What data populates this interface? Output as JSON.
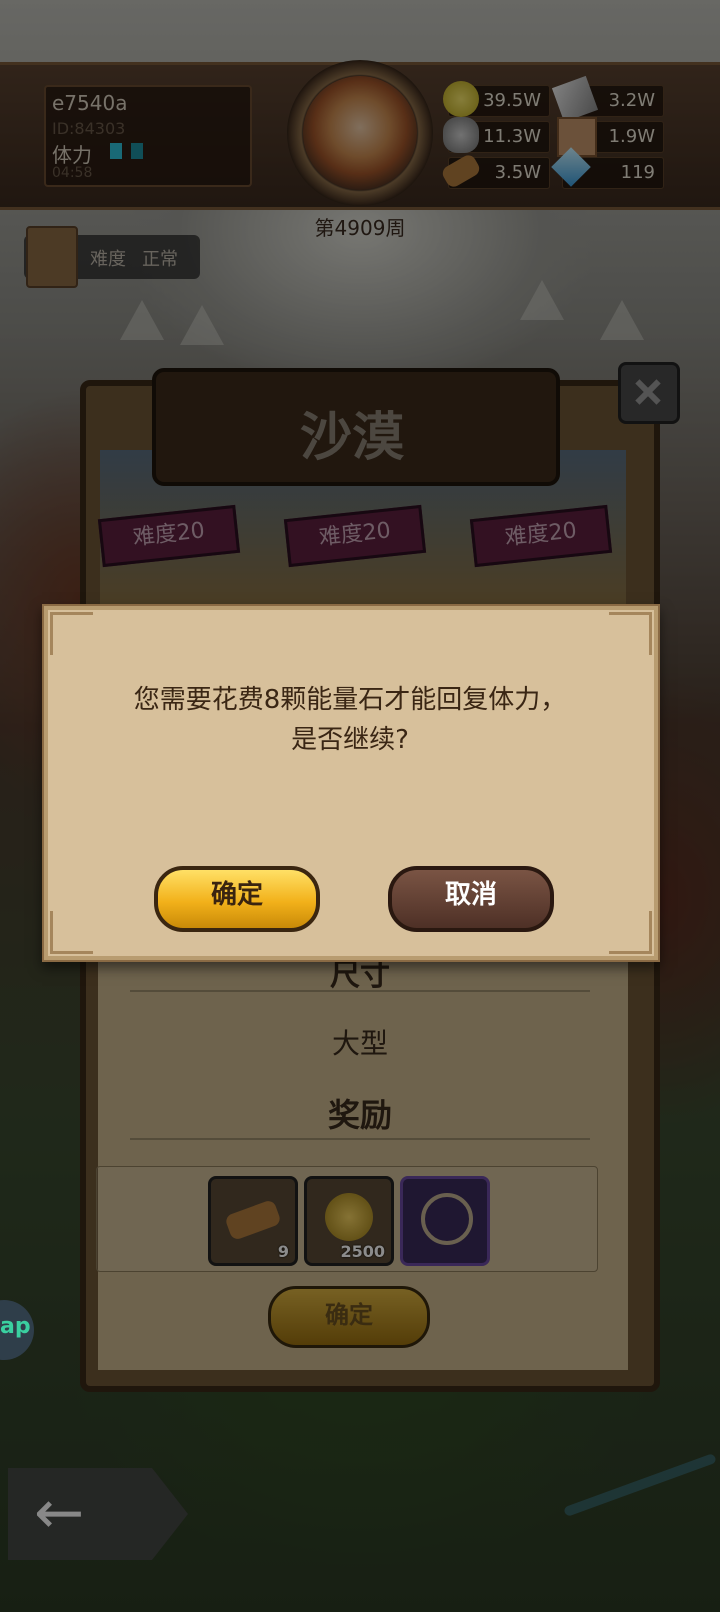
{
  "player": {
    "name": "e7540a",
    "id": "ID:84303",
    "stamina_label": "体力",
    "stamina_timer": "04:58"
  },
  "resources": [
    {
      "icon": "gold-coin-icon",
      "value": "39.5W"
    },
    {
      "icon": "iron-ingot-icon",
      "value": "3.2W"
    },
    {
      "icon": "stone-ore-icon",
      "value": "11.3W"
    },
    {
      "icon": "leather-icon",
      "value": "1.9W"
    },
    {
      "icon": "wood-log-icon",
      "value": "3.5W"
    },
    {
      "icon": "crystal-icon",
      "value": "119"
    }
  ],
  "week_label": "第4909周",
  "difficulty_tag": {
    "label": "难度",
    "value": "正常"
  },
  "panel": {
    "title": "沙漠",
    "stages": [
      "难度20",
      "难度20",
      "难度20"
    ],
    "size_label": "尺寸",
    "size_value": "大型",
    "reward_label": "奖励",
    "rewards": [
      {
        "icon": "wood-log-icon",
        "count": "9"
      },
      {
        "icon": "gold-bag-icon",
        "count": "2500"
      },
      {
        "icon": "whip-icon",
        "count": ""
      }
    ],
    "confirm_label": "确定"
  },
  "dialog": {
    "message_line1": "您需要花费8颗能量石才能回复体力，",
    "message_line2": "是否继续?",
    "ok_label": "确定",
    "cancel_label": "取消"
  },
  "side_bubble_text": "ap",
  "colors": {
    "dialog_bg": "#d7c09b",
    "ok_button": "#f2b11a",
    "cancel_button": "#5e3a2e"
  }
}
